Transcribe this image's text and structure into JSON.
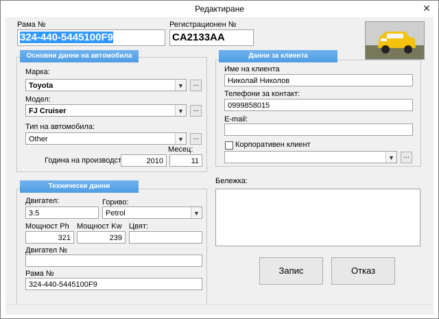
{
  "window": {
    "title": "Редактиране"
  },
  "header": {
    "frame_label": "Рама №",
    "frame_value": "324-440-5445100F9",
    "reg_label": "Регистрационен №",
    "reg_value": "CA2133AA"
  },
  "car_group": {
    "title": "Основни данни на автомобила",
    "make_label": "Марка:",
    "make_value": "Toyota",
    "model_label": "Модел:",
    "model_value": "FJ Cruiser",
    "type_label": "Тип на автомобила:",
    "type_value": "Other",
    "year_label": "Година на производство:",
    "year_value": "2010",
    "month_label": "Месец:",
    "month_value": "11"
  },
  "tech_group": {
    "title": "Технически данни",
    "engine_label": "Двигател:",
    "engine_value": "3.5",
    "fuel_label": "Гориво:",
    "fuel_value": "Petrol",
    "power_hp_label": "Мощност Ph",
    "power_hp_value": "321",
    "power_kw_label": "Мощност Kw",
    "power_kw_value": "239",
    "color_label": "Цвят:",
    "color_value": "",
    "engine_no_label": "Двигател №",
    "engine_no_value": "",
    "frame_label": "Рама №",
    "frame_value": "324-440-5445100F9"
  },
  "client_group": {
    "title": "Данни за клиента",
    "name_label": "Име на клиента",
    "name_value": "Николай Николов",
    "phones_label": "Телефони за контакт:",
    "phones_value": "0999858015",
    "email_label": "E-mail:",
    "email_value": "",
    "corporate_label": "Корпоративен клиент",
    "corporate_checked": false,
    "corporate_select_value": ""
  },
  "note": {
    "label": "Бележка:",
    "value": ""
  },
  "buttons": {
    "save": "Запис",
    "cancel": "Отказ",
    "browse": "..."
  },
  "icons": {
    "close": "close-icon",
    "dropdown": "chevron-down-icon"
  },
  "colors": {
    "group_header": "#5aa5e8",
    "selection": "#3399ff"
  }
}
